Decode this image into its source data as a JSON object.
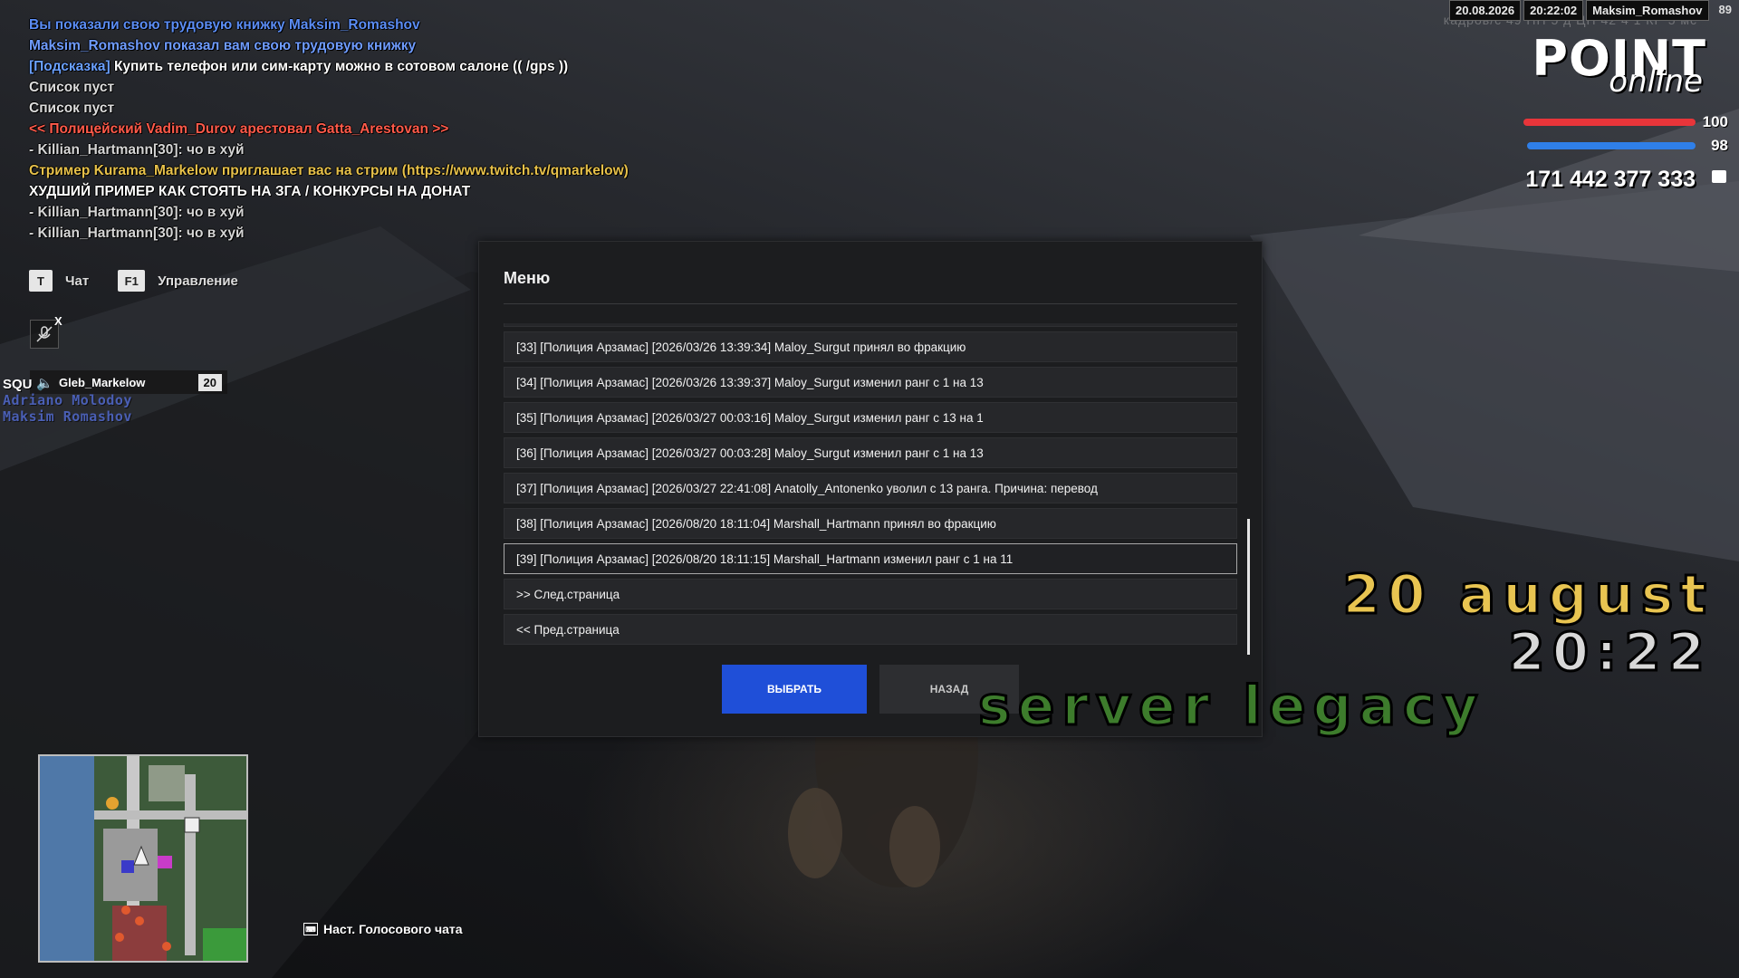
{
  "top": {
    "date": "20.08.2026",
    "time": "20:22:02",
    "nickname": "Maksim_Romashov",
    "ping": "89",
    "faint_stats": "кадров/с  49    ПП  5 д    ЦП 42 4    1 КР  5 мс"
  },
  "chat": {
    "lines": [
      {
        "text": "Вы показали свою трудовую книжку Maksim_Romashov",
        "color": "#5b8df5"
      },
      {
        "text": "Maksim_Romashov показал вам свою трудовую книжку",
        "color": "#6f9cff"
      },
      {
        "tag": "[Подсказка]",
        "text": " Купить телефон или сим-карту можно в сотовом салоне (( /gps ))",
        "color": "#ffffff"
      },
      {
        "text": "Список пуст",
        "color": "#dcdcdc"
      },
      {
        "text": "Список пуст",
        "color": "#dcdcdc"
      },
      {
        "text": "<< Полицейский Vadim_Durov арестовал Gatta_Arestovan >>",
        "color": "#ff5a4a"
      },
      {
        "text": "- Killian_Hartmann[30]: чо в хуй",
        "color": "#d6d6d6"
      },
      {
        "text": "Стример Kurama_Markelow приглашает вас на стрим (https://www.twitch.tv/qmarkelow)",
        "color": "#e7c14a"
      },
      {
        "text": "ХУДШИЙ ПРИМЕР КАК СТОЯТЬ НА ЗГА / КОНКУРСЫ НА ДОНАТ",
        "color": "#ffffff"
      },
      {
        "text": "- Killian_Hartmann[30]: чо в хуй",
        "color": "#d6d6d6"
      },
      {
        "text": "- Killian_Hartmann[30]: чо в хуй",
        "color": "#d6d6d6"
      }
    ]
  },
  "hotkeys": {
    "chat_key": "T",
    "chat_label": "Чат",
    "control_key": "F1",
    "control_label": "Управление"
  },
  "mic_close": "X",
  "squad": {
    "label": "SQU",
    "player": "Gleb_Markelow",
    "player_level": "20",
    "members": [
      "Adriano Molodoy",
      "Maksim Romashov"
    ]
  },
  "hud": {
    "logo_main": "POINT",
    "logo_sub": "online",
    "health": "100",
    "health_level": 1.0,
    "armor": "98",
    "armor_level": 0.98,
    "money": "171 442 377 333",
    "health_color": "#e8353a",
    "armor_color": "#2f7fe8"
  },
  "overlay": {
    "date": "20 august",
    "time": "20:22",
    "server": "server legacy"
  },
  "menu": {
    "title": "Меню",
    "items": [
      "[33] [Полиция Арзамас] [2026/03/26 13:39:34] Maloy_Surgut принял во фракцию",
      "[34] [Полиция Арзамас] [2026/03/26 13:39:37] Maloy_Surgut изменил ранг с 1 на 13",
      "[35] [Полиция Арзамас] [2026/03/27 00:03:16] Maloy_Surgut изменил ранг с 13 на 1",
      "[36] [Полиция Арзамас] [2026/03/27 00:03:28] Maloy_Surgut изменил ранг с 1 на 13",
      "[37] [Полиция Арзамас] [2026/03/27 22:41:08] Anatolly_Antonenko уволил с 13 ранга. Причина: перевод",
      "[38] [Полиция Арзамас] [2026/08/20 18:11:04] Marshall_Hartmann принял во фракцию",
      "[39] [Полиция Арзамас] [2026/08/20 18:11:15] Marshall_Hartmann изменил ранг с 1 на 11",
      ">> След.страница",
      "<< Пред.страница"
    ],
    "selected_index": 6,
    "select_label": "ВЫБРАТЬ",
    "back_label": "НАЗАД"
  },
  "voice": {
    "key_icon": "keyboard-icon",
    "label": "Наст. Голосового чата"
  }
}
